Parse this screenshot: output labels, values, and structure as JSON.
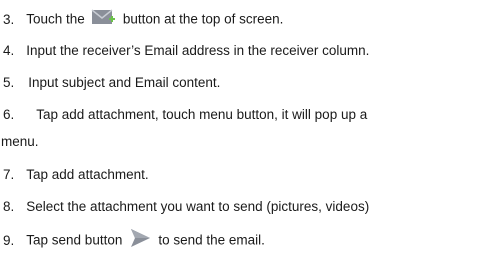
{
  "steps": [
    {
      "num": "3.",
      "before": "Touch the",
      "after": "button at the top of screen."
    },
    {
      "num": "4.",
      "text": "Input the receiver’s Email address in the receiver column."
    },
    {
      "num": "5.",
      "text": "Input subject and Email content."
    },
    {
      "num": "6.",
      "text": "Tap add attachment, touch menu button, it will pop up a",
      "cont": "menu."
    },
    {
      "num": "7.",
      "text": "Tap add attachment."
    },
    {
      "num": "8.",
      "text": "Select the attachment you want to send (pictures, videos)"
    },
    {
      "num": "9.",
      "before": "Tap send button",
      "after": "to send the email."
    }
  ],
  "icons": {
    "compose": "compose-email-icon",
    "send": "send-arrow-icon"
  },
  "colors": {
    "icon_gray": "#8a8f99",
    "icon_green": "#6cc24a",
    "text": "#1a1a1a"
  }
}
